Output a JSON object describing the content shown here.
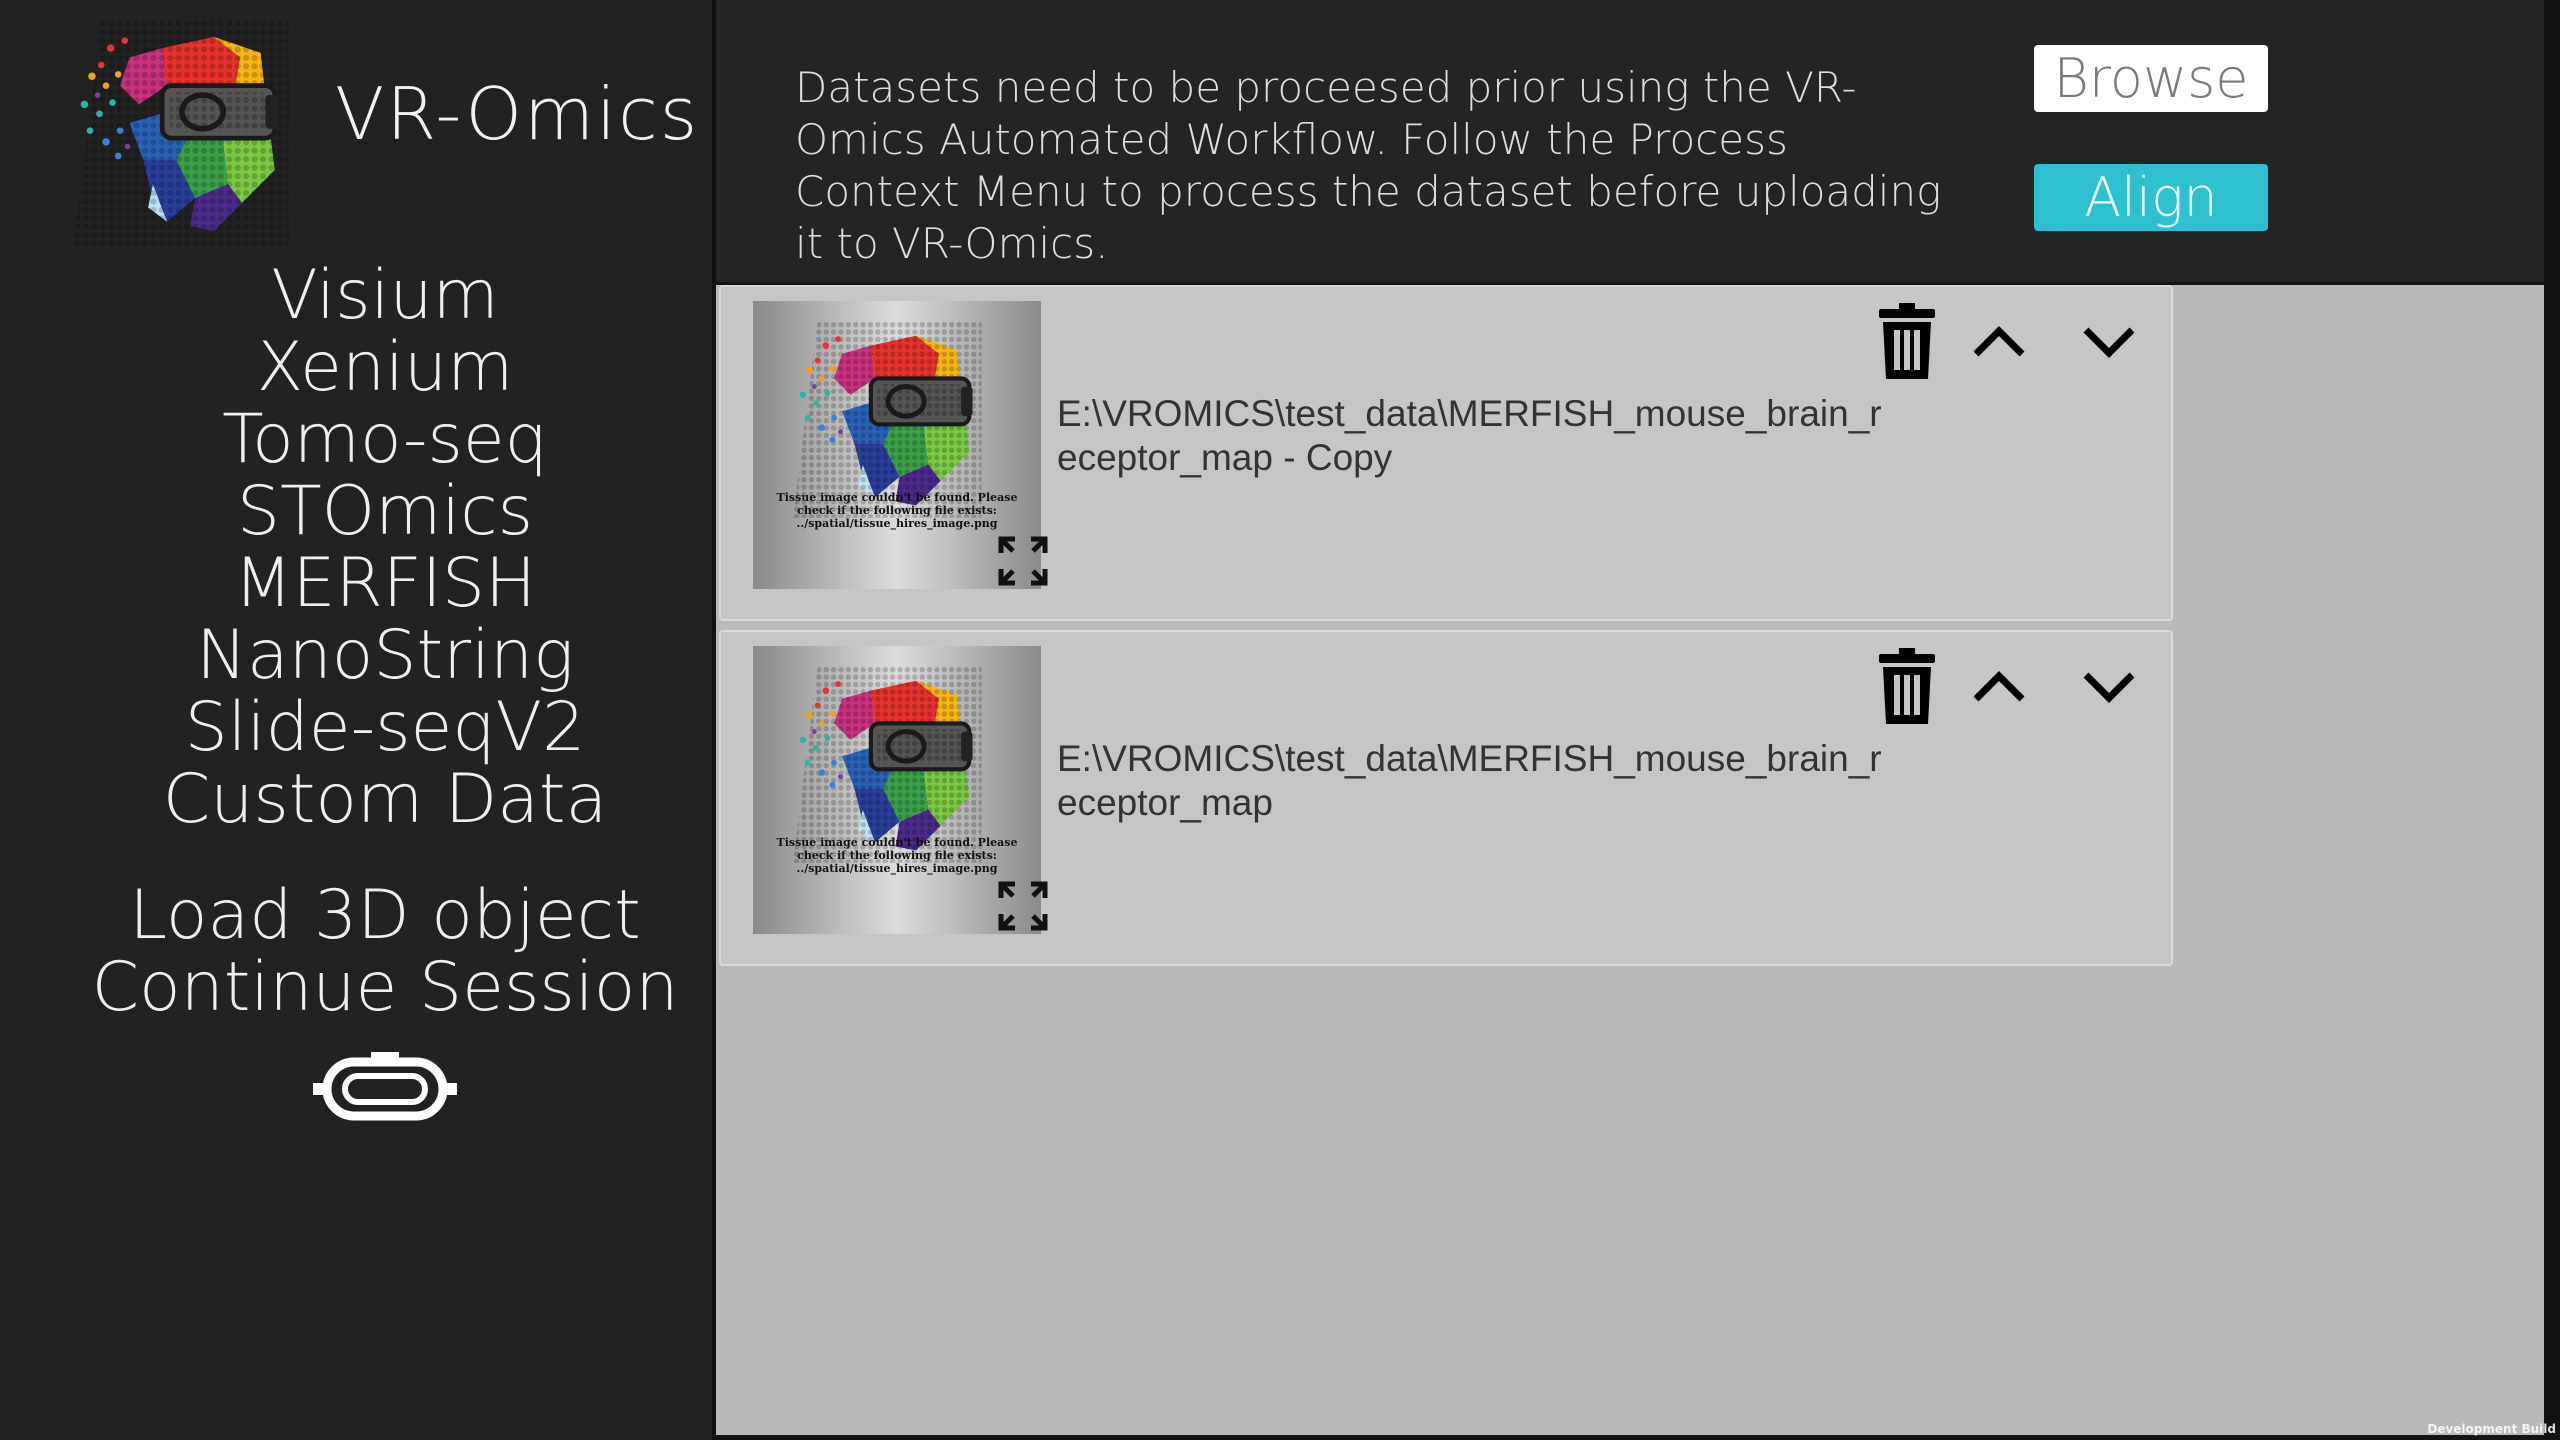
{
  "app": {
    "title": "VR-Omics"
  },
  "sidebar": {
    "menu": [
      "Visium",
      "Xenium",
      "Tomo-seq",
      "STOmics",
      "MERFISH",
      "NanoString",
      "Slide-seqV2",
      "Custom Data"
    ],
    "secondary": [
      "Load 3D object",
      "Continue Session"
    ]
  },
  "header": {
    "info": "Datasets need to be proceesed prior using the VR-Omics Automated Workflow. Follow the Process Context Menu to process the dataset before uploading it to VR-Omics.",
    "browse_label": "Browse",
    "align_label": "Align"
  },
  "datasets": [
    {
      "path": "E:\\VROMICS\\test_data\\MERFISH_mouse_brain_receptor_map - Copy",
      "thumbnail_message": "Tissue image couldn't be found. Please check if the following file exists: ../spatial/tissue_hires_image.png"
    },
    {
      "path": "E:\\VROMICS\\test_data\\MERFISH_mouse_brain_receptor_map",
      "thumbnail_message": "Tissue image couldn't be found. Please check if the following file exists: ../spatial/tissue_hires_image.png"
    }
  ],
  "footer": {
    "build": "Development Build"
  },
  "colors": {
    "accent": "#2fc0d0",
    "sidebar": "#222222",
    "list_bg": "#b9b9b9"
  }
}
